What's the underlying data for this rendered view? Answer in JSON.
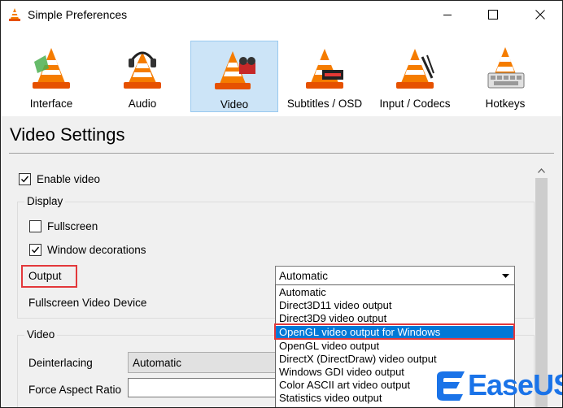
{
  "window": {
    "title": "Simple Preferences"
  },
  "categories": [
    {
      "label": "Interface",
      "selected": false
    },
    {
      "label": "Audio",
      "selected": false
    },
    {
      "label": "Video",
      "selected": true
    },
    {
      "label": "Subtitles / OSD",
      "selected": false
    },
    {
      "label": "Input / Codecs",
      "selected": false
    },
    {
      "label": "Hotkeys",
      "selected": false
    }
  ],
  "heading": "Video Settings",
  "settings": {
    "enable_video": {
      "label": "Enable video",
      "checked": true
    },
    "display": {
      "title": "Display",
      "fullscreen": {
        "label": "Fullscreen",
        "checked": false
      },
      "window_decorations": {
        "label": "Window decorations",
        "checked": true
      },
      "output": {
        "label": "Output",
        "value": "Automatic",
        "options": [
          "Automatic",
          "Direct3D11 video output",
          "Direct3D9 video output",
          "OpenGL video output for Windows",
          "OpenGL video output",
          "DirectX (DirectDraw) video output",
          "Windows GDI video output",
          "Color ASCII art video output",
          "Statistics video output"
        ],
        "highlighted": "OpenGL video output for Windows"
      },
      "fullscreen_device": {
        "label": "Fullscreen Video Device"
      }
    },
    "video": {
      "title": "Video",
      "deinterlacing": {
        "label": "Deinterlacing",
        "value": "Automatic"
      },
      "force_aspect_ratio": {
        "label": "Force Aspect Ratio",
        "value": ""
      }
    }
  },
  "watermark": {
    "text": "EaseUS"
  },
  "colors": {
    "accent": "#0078d7",
    "highlight_border": "#e3383b",
    "selected_tab": "#cce4f7",
    "watermark": "#1a73e8"
  }
}
